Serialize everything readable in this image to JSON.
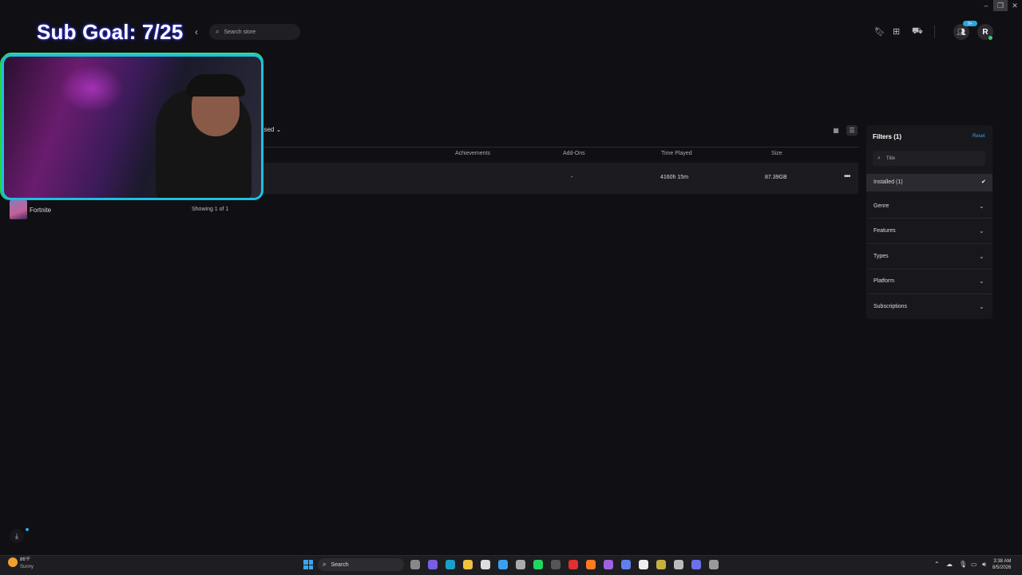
{
  "overlay": {
    "subgoal": "Sub Goal: 7/25"
  },
  "header": {
    "back_icon": "chevron-left-icon",
    "search_placeholder": "Search store",
    "friends_badge": "9+",
    "avatar_initial": "R"
  },
  "library": {
    "sort_label": "ased",
    "columns": {
      "achievements": "Achievements",
      "addons": "Add-Ons",
      "time_played": "Time Played",
      "size": "Size"
    },
    "row": {
      "achievements": "",
      "addons": "-",
      "time_played": "4160h 15m",
      "size": "87.39GB"
    },
    "game_name": "Fortnite",
    "showing": "Showing 1 of 1"
  },
  "filters": {
    "title": "Filters (1)",
    "reset": "Reset",
    "search_placeholder": "Title",
    "items": [
      {
        "label": "Installed (1)"
      },
      {
        "label": "Genre"
      },
      {
        "label": "Features"
      },
      {
        "label": "Types"
      },
      {
        "label": "Platform"
      },
      {
        "label": "Subscriptions"
      }
    ]
  },
  "taskbar": {
    "temperature": "86°F",
    "condition": "Sunny",
    "search_label": "Search",
    "time": "3:38 AM",
    "date": "8/5/2026"
  },
  "colors": {
    "accent": "#3aa9f0",
    "background": "#101014",
    "panel": "#18181c",
    "cam_border": "#1ec0e0"
  }
}
